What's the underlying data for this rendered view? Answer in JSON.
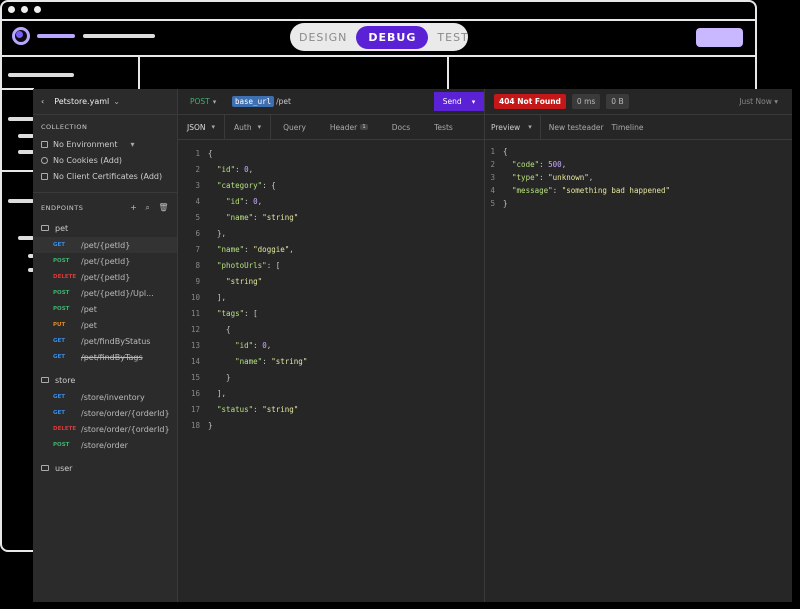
{
  "header": {
    "modes": [
      "DESIGN",
      "DEBUG",
      "TEST"
    ],
    "active_mode": "DEBUG"
  },
  "sidebar": {
    "file_name": "Petstore.yaml",
    "collection_label": "COLLECTION",
    "collection_items": [
      "No Environment",
      "No Cookies (Add)",
      "No Client Certificates (Add)"
    ],
    "endpoints_label": "ENDPOINTS",
    "groups": [
      {
        "name": "pet",
        "endpoints": [
          {
            "method": "GET",
            "path": "/pet/{petId}"
          },
          {
            "method": "POST",
            "path": "/pet/{petId}"
          },
          {
            "method": "DELETE",
            "path": "/pet/{petId}"
          },
          {
            "method": "POST",
            "path": "/pet/{petId}/Upl..."
          },
          {
            "method": "POST",
            "path": "/pet"
          },
          {
            "method": "PUT",
            "path": "/pet"
          },
          {
            "method": "GET",
            "path": "/pet/findByStatus"
          },
          {
            "method": "GET",
            "path": "/pet/findByTags"
          }
        ]
      },
      {
        "name": "store",
        "endpoints": [
          {
            "method": "GET",
            "path": "/store/inventory"
          },
          {
            "method": "GET",
            "path": "/store/order/{orderId}"
          },
          {
            "method": "DELETE",
            "path": "/store/order/{orderId}"
          },
          {
            "method": "POST",
            "path": "/store/order"
          }
        ]
      },
      {
        "name": "user",
        "endpoints": []
      }
    ]
  },
  "request": {
    "method": "POST",
    "base_url": "base_url",
    "path": "/pet",
    "send_label": "Send",
    "tabs": [
      "JSON",
      "Auth",
      "Query",
      "Header",
      "Docs",
      "Tests"
    ],
    "header_count": "1",
    "body_lines": [
      "{",
      "  \"id\": 0,",
      "  \"category\": {",
      "    \"id\": 0,",
      "    \"name\": \"string\"",
      "  },",
      "  \"name\": \"doggie\",",
      "  \"photoUrls\": [",
      "    \"string\"",
      "  ],",
      "  \"tags\": [",
      "    {",
      "      \"id\": 0,",
      "      \"name\": \"string\"",
      "    }",
      "  ],",
      "  \"status\": \"string\"",
      "}"
    ]
  },
  "response": {
    "status": "404 Not Found",
    "time": "0 ms",
    "size": "0 B",
    "when": "Just Now",
    "tabs": [
      "Preview",
      "New testeader",
      "Timeline"
    ],
    "body_lines": [
      "{",
      "  \"code\": 500,",
      "  \"type\": \"unknown\",",
      "  \"message\": \"something bad happened\"",
      "}"
    ]
  },
  "colors": {
    "accent": "#5a22d4",
    "get": "#3e8ce0",
    "post": "#3cb36b",
    "delete": "#d63b3b",
    "put": "#e08a24",
    "error": "#c41818"
  }
}
